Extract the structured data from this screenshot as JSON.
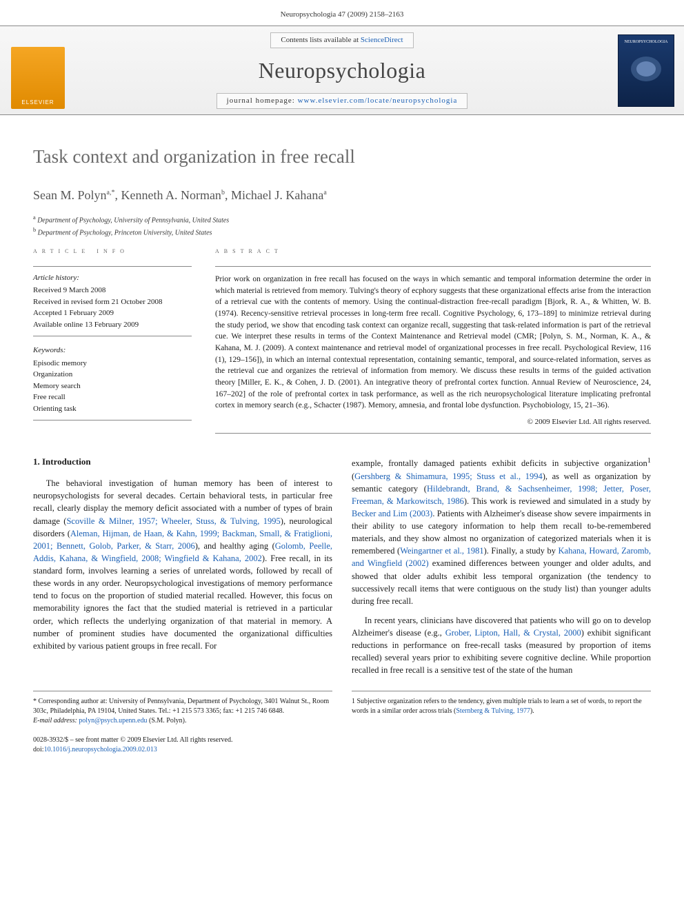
{
  "header": {
    "running": "Neuropsychologia 47 (2009) 2158–2163"
  },
  "masthead": {
    "elsevier": "ELSEVIER",
    "contents_prefix": "Contents lists available at ",
    "contents_link": "ScienceDirect",
    "journal": "Neuropsychologia",
    "homepage_prefix": "journal homepage: ",
    "homepage_url": "www.elsevier.com/locate/neuropsychologia",
    "cover_label": "NEUROPSYCHOLOGIA"
  },
  "article": {
    "title": "Task context and organization in free recall",
    "authors_html": "Sean M. Polyn",
    "author1_sup": "a,*",
    "author2": ", Kenneth A. Norman",
    "author2_sup": "b",
    "author3": ", Michael J. Kahana",
    "author3_sup": "a",
    "aff_a": "a Department of Psychology, University of Pennsylvania, United States",
    "aff_b": "b Department of Psychology, Princeton University, United States"
  },
  "info": {
    "heading": "article info",
    "history_head": "Article history:",
    "received": "Received 9 March 2008",
    "revised": "Received in revised form 21 October 2008",
    "accepted": "Accepted 1 February 2009",
    "online": "Available online 13 February 2009",
    "keywords_head": "Keywords:",
    "kw1": "Episodic memory",
    "kw2": "Organization",
    "kw3": "Memory search",
    "kw4": "Free recall",
    "kw5": "Orienting task"
  },
  "abstract": {
    "heading": "abstract",
    "text": "Prior work on organization in free recall has focused on the ways in which semantic and temporal information determine the order in which material is retrieved from memory. Tulving's theory of ecphory suggests that these organizational effects arise from the interaction of a retrieval cue with the contents of memory. Using the continual-distraction free-recall paradigm [Bjork, R. A., & Whitten, W. B. (1974). Recency-sensitive retrieval processes in long-term free recall. Cognitive Psychology, 6, 173–189] to minimize retrieval during the study period, we show that encoding task context can organize recall, suggesting that task-related information is part of the retrieval cue. We interpret these results in terms of the Context Maintenance and Retrieval model (CMR; [Polyn, S. M., Norman, K. A., & Kahana, M. J. (2009). A context maintenance and retrieval model of organizational processes in free recall. Psychological Review, 116 (1), 129–156]), in which an internal contextual representation, containing semantic, temporal, and source-related information, serves as the retrieval cue and organizes the retrieval of information from memory. We discuss these results in terms of the guided activation theory [Miller, E. K., & Cohen, J. D. (2001). An integrative theory of prefrontal cortex function. Annual Review of Neuroscience, 24, 167–202] of the role of prefrontal cortex in task performance, as well as the rich neuropsychological literature implicating prefrontal cortex in memory search (e.g., Schacter (1987). Memory, amnesia, and frontal lobe dysfunction. Psychobiology, 15, 21–36).",
    "copyright": "© 2009 Elsevier Ltd. All rights reserved."
  },
  "body": {
    "intro_head": "1. Introduction",
    "col1_p1a": "The behavioral investigation of human memory has been of interest to neuropsychologists for several decades. Certain behavioral tests, in particular free recall, clearly display the memory deficit associated with a number of types of brain damage (",
    "cite1": "Scoville & Milner, 1957; Wheeler, Stuss, & Tulving, 1995",
    "col1_p1b": "), neurological disorders (",
    "cite2": "Aleman, Hijman, de Haan, & Kahn, 1999; Backman, Small, & Fratiglioni, 2001; Bennett, Golob, Parker, & Starr, 2006",
    "col1_p1c": "), and healthy aging (",
    "cite3": "Golomb, Peelle, Addis, Kahana, & Wingfield, 2008; Wingfield & Kahana, 2002",
    "col1_p1d": "). Free recall, in its standard form, involves learning a series of unrelated words, followed by recall of these words in any order. Neuropsychological investigations of memory performance tend to focus on the proportion of studied material recalled. However, this focus on memorability ignores the fact that the studied material is retrieved in a particular order, which reflects the underlying organization of that material in memory. A number of prominent studies have documented the organizational difficulties exhibited by various patient groups in free recall. For",
    "col2_p1a": "example, frontally damaged patients exhibit deficits in subjective organization",
    "fn1": "1",
    "col2_p1b": " (",
    "cite4": "Gershberg & Shimamura, 1995; Stuss et al., 1994",
    "col2_p1c": "), as well as organization by semantic category (",
    "cite5": "Hildebrandt, Brand, & Sachsenheimer, 1998; Jetter, Poser, Freeman, & Markowitsch, 1986",
    "col2_p1d": "). This work is reviewed and simulated in a study by ",
    "cite6": "Becker and Lim (2003)",
    "col2_p1e": ". Patients with Alzheimer's disease show severe impairments in their ability to use category information to help them recall to-be-remembered materials, and they show almost no organization of categorized materials when it is remembered (",
    "cite7": "Weingartner et al., 1981",
    "col2_p1f": "). Finally, a study by ",
    "cite8": "Kahana, Howard, Zaromb, and Wingfield (2002)",
    "col2_p1g": " examined differences between younger and older adults, and showed that older adults exhibit less temporal organization (the tendency to successively recall items that were contiguous on the study list) than younger adults during free recall.",
    "col2_p2a": "In recent years, clinicians have discovered that patients who will go on to develop Alzheimer's disease (e.g., ",
    "cite9": "Grober, Lipton, Hall, & Crystal, 2000",
    "col2_p2b": ") exhibit significant reductions in performance on free-recall tasks (measured by proportion of items recalled) several years prior to exhibiting severe cognitive decline. While proportion recalled in free recall is a sensitive test of the state of the human"
  },
  "corr": {
    "star": "* Corresponding author at: University of Pennsylvania, Department of Psychology, 3401 Walnut St., Room 303c, Philadelphia, PA 19104, United States. Tel.: +1 215 573 3365; fax: +1 215 746 6848.",
    "email_label": "E-mail address: ",
    "email": "polyn@psych.upenn.edu",
    "email_suffix": " (S.M. Polyn).",
    "fn_text": "1 Subjective organization refers to the tendency, given multiple trials to learn a set of words, to report the words in a similar order across trials (",
    "fn_cite": "Sternberg & Tulving, 1977",
    "fn_suffix": ")."
  },
  "footer": {
    "line1": "0028-3932/$ – see front matter © 2009 Elsevier Ltd. All rights reserved.",
    "doi_label": "doi:",
    "doi": "10.1016/j.neuropsychologia.2009.02.013"
  }
}
